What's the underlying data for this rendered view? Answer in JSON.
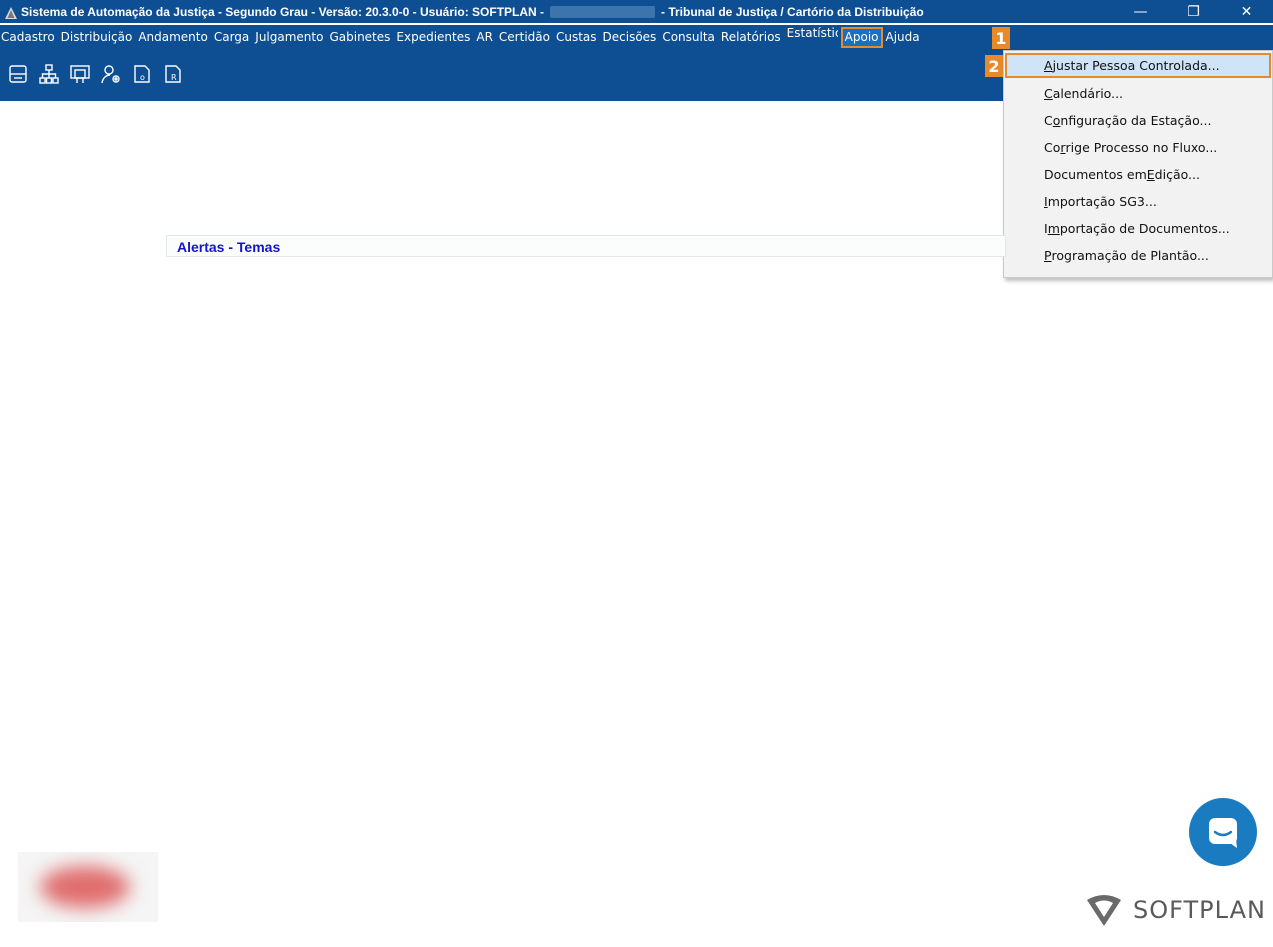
{
  "titlebar": {
    "title_prefix": "Sistema de Automação da Justiça - Segundo Grau - Versão: 20.3.0-0 - Usuário: SOFTPLAN -",
    "title_suffix": "- Tribunal de Justiça / Cartório da Distribuição",
    "minimize": "—",
    "restore": "❐",
    "close": "✕"
  },
  "menubar": {
    "items": [
      "Cadastro",
      "Distribuição",
      "Andamento",
      "Carga",
      "Julgamento",
      "Gabinetes",
      "Expedientes",
      "AR",
      "Certidão",
      "Custas",
      "Decisões",
      "Consulta",
      "Relatórios"
    ],
    "estatistica_clipped": "Estatística",
    "apoio": "Apoio",
    "ajuda": "Ajuda"
  },
  "toolbar": {
    "icons": [
      "printer-icon",
      "org-chart-icon",
      "presentation-icon",
      "user-settings-icon",
      "document-o-icon",
      "document-r-icon"
    ]
  },
  "badges": {
    "step1": "1",
    "step2": "2"
  },
  "dropdown": {
    "items": [
      {
        "pre": "",
        "u": "A",
        "post": "justar Pessoa Controlada..."
      },
      {
        "pre": "",
        "u": "C",
        "post": "alendário..."
      },
      {
        "pre": "C",
        "u": "o",
        "post": "nfiguração da Estação..."
      },
      {
        "pre": "Co",
        "u": "r",
        "post": "rige Processo no Fluxo..."
      },
      {
        "pre": "Documentos em ",
        "u": "E",
        "post": "dição..."
      },
      {
        "pre": "",
        "u": "I",
        "post": "mportação SG3..."
      },
      {
        "pre": "I",
        "u": "m",
        "post": "portação de Documentos..."
      },
      {
        "pre": "",
        "u": "P",
        "post": "rogramação de Plantão..."
      }
    ]
  },
  "alerts": {
    "label": "Alertas - Temas"
  },
  "branding": {
    "name": "SOFTPLAN"
  },
  "colors": {
    "primary": "#0e4f94",
    "highlight": "#e78a2b",
    "chat": "#1a7bc1",
    "alert_text": "#1414cc"
  }
}
